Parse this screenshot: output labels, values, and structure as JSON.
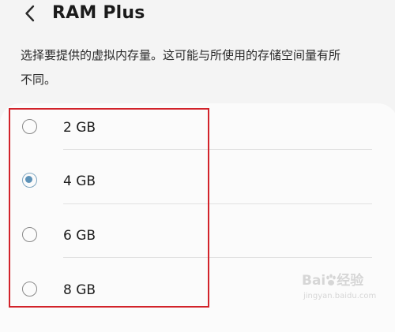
{
  "header": {
    "back_icon": "chevron-left-icon",
    "title": "RAM Plus"
  },
  "description": {
    "line1": "选择要提供的虚拟内存量。这可能与所使用的存储空间量有所",
    "line2": "不同。"
  },
  "options": [
    {
      "label": "2 GB",
      "selected": false
    },
    {
      "label": "4 GB",
      "selected": true
    },
    {
      "label": "6 GB",
      "selected": false
    },
    {
      "label": "8 GB",
      "selected": false
    }
  ],
  "watermark": {
    "brand_left": "Bai",
    "brand_right": "经验",
    "domain": "jingyan.baidu.com"
  },
  "colors": {
    "background": "#f4f4f4",
    "card": "#fbfbfb",
    "radio_selected": "#5d92b8",
    "highlight": "#d2232a"
  }
}
